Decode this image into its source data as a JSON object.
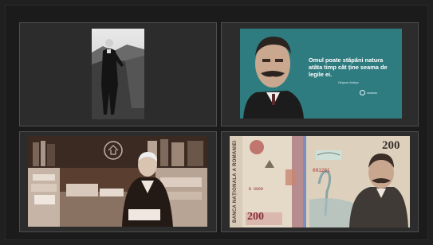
{
  "quote": {
    "text": "Omul poate stăpâni natura atâta timp cât ține seama de legile ei.",
    "author": "Grigore Antipa",
    "logo": "ccurioso"
  },
  "banknote": {
    "bank_name": "BANCA NAȚIONALĂ A ROMÂNIEI",
    "value": "200",
    "value_bottom": "200",
    "serial": "001291",
    "serial_left": "B 0000"
  },
  "colors": {
    "background": "#202020",
    "tile_border": "#4e4e4e",
    "quote_bg": "#2f7c80"
  }
}
